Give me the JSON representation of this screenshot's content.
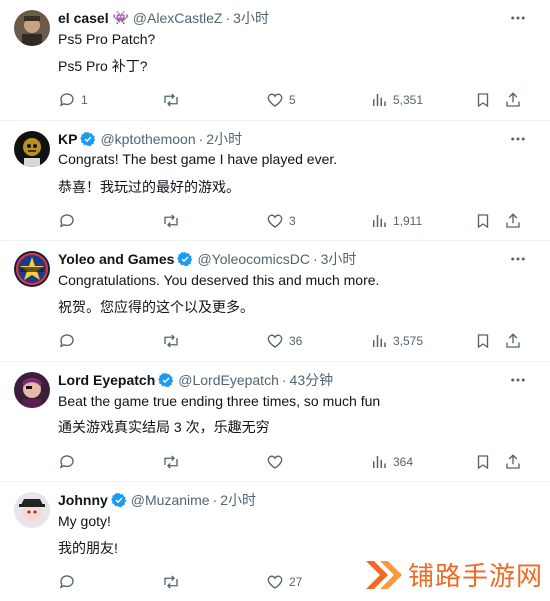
{
  "tweets": [
    {
      "name": "el casel",
      "emoji_badge": "👾",
      "handle": "@AlexCastleZ",
      "time": "3小时",
      "verified": false,
      "lines": [
        "Ps5 Pro Patch?",
        "Ps5 Pro 补丁?"
      ],
      "replies": "1",
      "retweets": "",
      "likes": "5",
      "views": "5,351"
    },
    {
      "name": "KP",
      "handle": "@kptothemoon",
      "time": "2小时",
      "verified": true,
      "lines": [
        "Congrats! The best game I have played ever.",
        "恭喜！我玩过的最好的游戏。"
      ],
      "replies": "",
      "retweets": "",
      "likes": "3",
      "views": "1,911"
    },
    {
      "name": "Yoleo and Games",
      "handle": "@YoleocomicsDC",
      "time": "3小时",
      "verified": true,
      "lines": [
        "Congratulations. You deserved this and much more.",
        "祝贺。您应得的这个以及更多。"
      ],
      "replies": "",
      "retweets": "",
      "likes": "36",
      "views": "3,575"
    },
    {
      "name": "Lord Eyepatch",
      "handle": "@LordEyepatch",
      "time": "43分钟",
      "verified": true,
      "lines": [
        "Beat the game true ending three times, so much fun",
        "通关游戏真实结局 3 次，乐趣无穷"
      ],
      "replies": "",
      "retweets": "",
      "likes": "",
      "views": "364"
    },
    {
      "name": "Johnny",
      "handle": "@Muzanime",
      "time": "2小时",
      "verified": true,
      "lines": [
        "My goty!",
        "我的朋友!"
      ],
      "replies": "",
      "retweets": "",
      "likes": "27",
      "views": ""
    }
  ],
  "separator": "·",
  "watermark": "铺路手游网",
  "colors": {
    "text": "#0f1419",
    "muted": "#536471",
    "verified": "#1d9bf0",
    "watermark": "#f06a25"
  }
}
